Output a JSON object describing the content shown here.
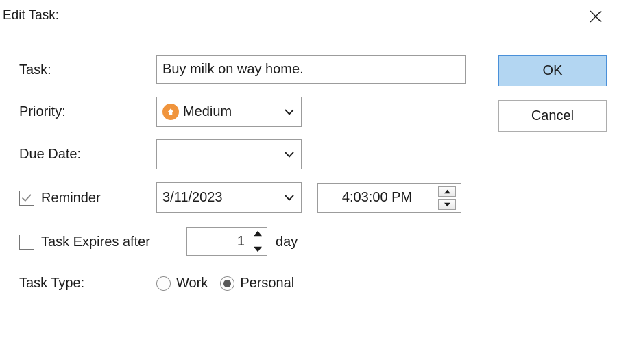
{
  "window": {
    "title": "Edit Task:",
    "close_icon": "close-icon"
  },
  "form": {
    "task": {
      "label": "Task:",
      "value": "Buy milk on way home.",
      "placeholder": ""
    },
    "priority": {
      "label": "Priority:",
      "value": "Medium",
      "icon": "priority-up-arrow-icon",
      "icon_color": "#f0943c",
      "dropdown_icon": "chevron-down-icon"
    },
    "due_date": {
      "label": "Due Date:",
      "value": "",
      "dropdown_icon": "chevron-down-icon"
    },
    "reminder": {
      "label": "Reminder",
      "checked": true,
      "check_icon": "checkmark-icon",
      "date_value": "3/11/2023",
      "dropdown_icon": "chevron-down-icon",
      "time_value": "4:03:00 PM",
      "spin_up_icon": "triangle-up-icon",
      "spin_down_icon": "triangle-down-icon"
    },
    "expires": {
      "label": "Task Expires after",
      "checked": false,
      "value": "1",
      "suffix": "day",
      "spin_up_icon": "triangle-up-icon",
      "spin_down_icon": "triangle-down-icon"
    },
    "task_type": {
      "label": "Task Type:",
      "options": [
        {
          "label": "Work",
          "selected": false
        },
        {
          "label": "Personal",
          "selected": true
        }
      ]
    }
  },
  "buttons": {
    "ok": "OK",
    "cancel": "Cancel",
    "default_fill": "#b3d6f2",
    "default_border": "#4a90d9"
  }
}
